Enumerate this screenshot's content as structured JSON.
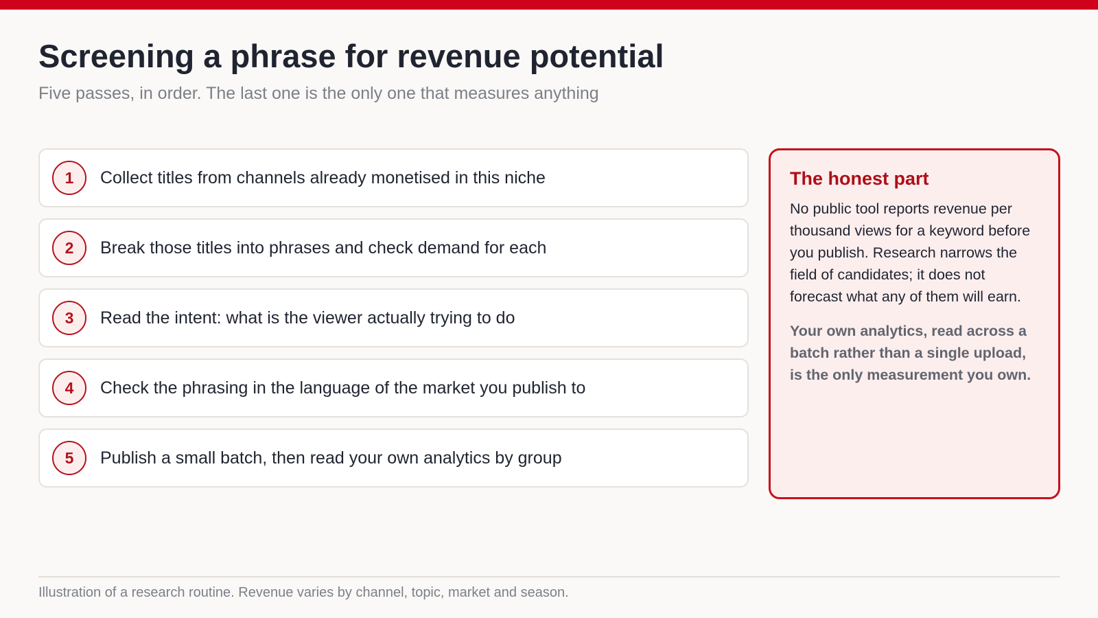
{
  "colors": {
    "accent": "#d0021b",
    "accent_dark": "#b3121c",
    "callout_background": "#fdeeee",
    "page_background": "#faf9f7",
    "text": "#1f2430",
    "muted": "#7b7f88"
  },
  "header": {
    "title": "Screening a phrase for revenue potential",
    "subtitle": "Five passes, in order. The last one is the only one that measures anything"
  },
  "steps": [
    {
      "number": "1",
      "text": "Collect titles from channels already monetised in this niche"
    },
    {
      "number": "2",
      "text": "Break those titles into phrases and check demand for each"
    },
    {
      "number": "3",
      "text": "Read the intent: what is the viewer actually trying to do"
    },
    {
      "number": "4",
      "text": "Check the phrasing in the language of the market you publish to"
    },
    {
      "number": "5",
      "text": "Publish a small batch, then read your own analytics by group"
    }
  ],
  "callout": {
    "title": "The honest part",
    "body": "No public tool reports revenue per thousand views for a keyword before you publish. Research narrows the field of candidates; it does not forecast what any of them will earn.",
    "emphasis": "Your own analytics, read across a batch rather than a single upload, is the only measurement you own."
  },
  "footer": {
    "note": "Illustration of a research routine. Revenue varies by channel, topic, market and season."
  }
}
